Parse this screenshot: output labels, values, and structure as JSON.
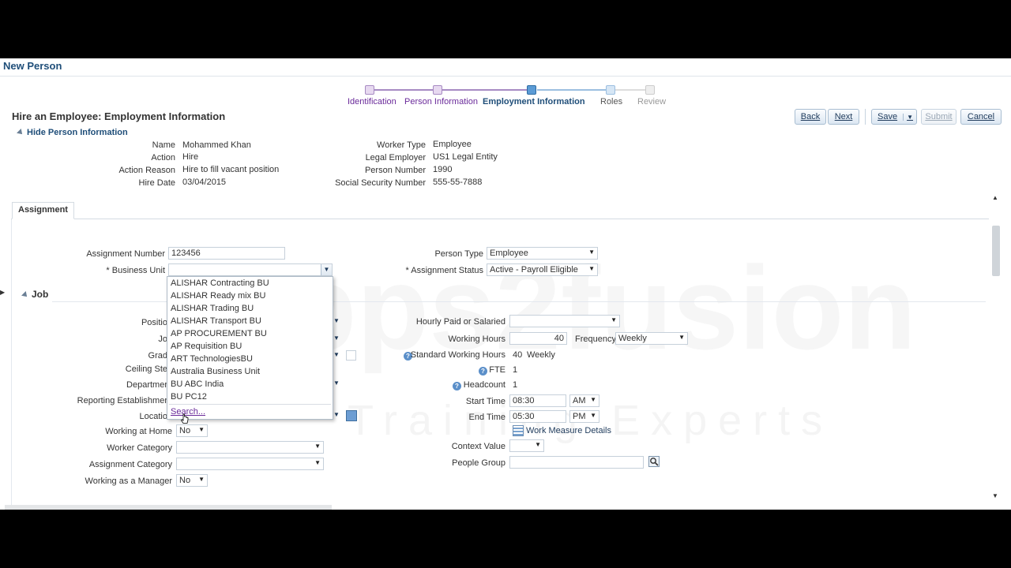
{
  "page_title": "New Person",
  "train": {
    "stops": [
      {
        "label": "Identification",
        "state": "done"
      },
      {
        "label": "Person Information",
        "state": "done"
      },
      {
        "label": "Employment Information",
        "state": "current"
      },
      {
        "label": "Roles",
        "state": "next"
      },
      {
        "label": "Review",
        "state": "off"
      }
    ]
  },
  "section_title": "Hire an Employee: Employment Information",
  "hide_link": "Hide Person Information",
  "buttons": {
    "back": "Back",
    "next": "Next",
    "save": "Save",
    "submit": "Submit",
    "cancel": "Cancel"
  },
  "person_info": {
    "left": [
      {
        "label": "Name",
        "value": "Mohammed Khan"
      },
      {
        "label": "Action",
        "value": "Hire"
      },
      {
        "label": "Action Reason",
        "value": "Hire to fill vacant position"
      },
      {
        "label": "Hire Date",
        "value": "03/04/2015"
      }
    ],
    "right": [
      {
        "label": "Worker Type",
        "value": "Employee"
      },
      {
        "label": "Legal Employer",
        "value": "US1 Legal Entity"
      },
      {
        "label": "Person Number",
        "value": "1990"
      },
      {
        "label": "Social Security Number",
        "value": "555-55-7888"
      }
    ]
  },
  "tabs": {
    "assignment": "Assignment"
  },
  "assignment": {
    "assignment_number_label": "Assignment Number",
    "assignment_number_value": "123456",
    "business_unit_label": "* Business Unit",
    "business_unit_value": "",
    "person_type_label": "Person Type",
    "person_type_value": "Employee",
    "assignment_status_label": "* Assignment Status",
    "assignment_status_value": "Active - Payroll Eligible"
  },
  "job_section": "Job",
  "job_left": {
    "position": "Positio",
    "job": "Jo",
    "grade": "Grad",
    "ceiling_step": "Ceiling Ste",
    "department": "Departmer",
    "reporting_establishment": "Reporting Establishmer",
    "location": "Locatio",
    "working_at_home_label": "Working at Home",
    "working_at_home_value": "No",
    "worker_category_label": "Worker Category",
    "worker_category_value": "",
    "assignment_category_label": "Assignment Category",
    "assignment_category_value": "",
    "working_as_manager_label": "Working as a Manager",
    "working_as_manager_value": "No"
  },
  "job_right": {
    "hourly_paid_label": "Hourly Paid or Salaried",
    "hourly_paid_value": "",
    "working_hours_label": "Working Hours",
    "working_hours_value": "40",
    "frequency_label": "Frequency",
    "frequency_value": "Weekly",
    "standard_working_hours_label": "Standard Working Hours",
    "standard_working_hours_value": "40",
    "standard_working_hours_unit": "Weekly",
    "fte_label": "FTE",
    "fte_value": "1",
    "headcount_label": "Headcount",
    "headcount_value": "1",
    "start_time_label": "Start Time",
    "start_time_value": "08:30",
    "start_time_ampm": "AM",
    "end_time_label": "End Time",
    "end_time_value": "05:30",
    "end_time_ampm": "PM",
    "work_measure_link": "Work Measure Details",
    "context_value_label": "Context Value",
    "context_value_value": "",
    "people_group_label": "People Group",
    "people_group_value": ""
  },
  "business_unit_dropdown": {
    "options": [
      "ALISHAR Contracting BU",
      "ALISHAR Ready mix BU",
      "ALISHAR Trading BU",
      "ALISHAR Transport BU",
      "AP PROCUREMENT BU",
      "AP Requisition BU",
      "ART TechnologiesBU",
      "Australia Business Unit",
      "BU ABC India",
      "BU PC12"
    ],
    "search_label": "Search..."
  },
  "watermark": {
    "line1": "pps2fusion",
    "line2": "Training Experts"
  },
  "colors": {
    "title_blue": "#1f4e79",
    "train_current": "#5b9bd5",
    "train_done": "#a78bc3",
    "link_purple": "#6a2a9a"
  }
}
